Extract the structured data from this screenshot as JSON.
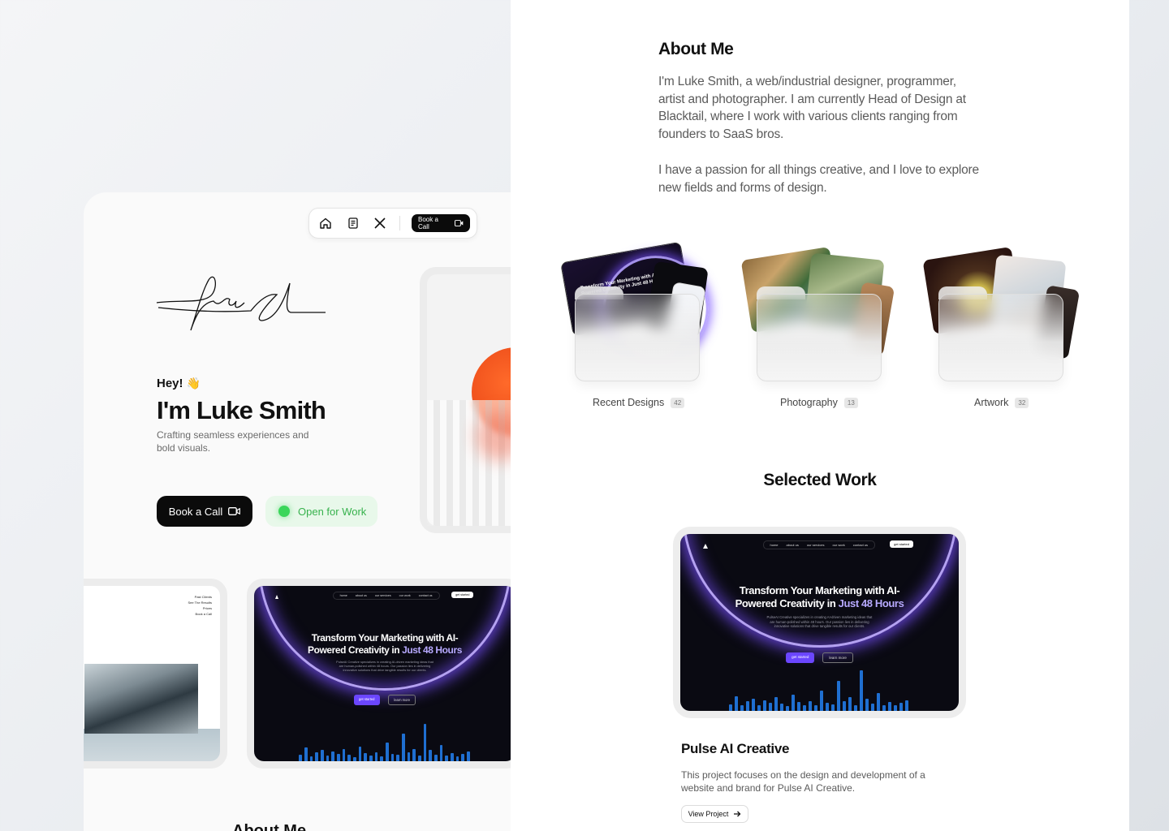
{
  "nav": {
    "icons": [
      "home-icon",
      "blog-icon",
      "x-logo-icon"
    ],
    "book_label": "Book a Call"
  },
  "hero": {
    "greeting": "Hey!",
    "greeting_emoji": "👋",
    "name": "I'm Luke Smith",
    "tagline": "Crafting seamless experiences and bold visuals.",
    "book_button": "Book a Call",
    "status_label": "Open for Work"
  },
  "arch_site": {
    "menu": [
      "Past Clients",
      "See The Results",
      "Prices",
      "Book a Call"
    ]
  },
  "pulse": {
    "nav": [
      "home",
      "about us",
      "our services",
      "our work",
      "contact us"
    ],
    "get_started": "get started",
    "title_line1": "Transform Your Marketing with AI-",
    "title_line2_a": "Powered Creativity in ",
    "title_line2_b": "Just 48 Hours",
    "desc": "PulseAI Creative specializes in creating AI-driven marketing ideas that are human-polished within 48 hours. Our passion lies in delivering innovative solutions that drive tangible results for our clients.",
    "btn_primary": "get started",
    "btn_secondary": "learn more",
    "bars": [
      10,
      22,
      8,
      14,
      18,
      9,
      16,
      12,
      20,
      11,
      7,
      24,
      13,
      9,
      15,
      8,
      30,
      12,
      10,
      44,
      14,
      20,
      9,
      60,
      18,
      11,
      26,
      9,
      13,
      8,
      12,
      16
    ]
  },
  "about_peek": "About Me",
  "about": {
    "title": "About Me",
    "p1": "I'm Luke Smith, a web/industrial designer, programmer, artist and photographer. I am currently Head of Design at Blacktail, where I work with various clients ranging from founders to SaaS bros.",
    "p2": "I have a passion for all things creative, and I love to explore new fields and forms of design."
  },
  "folders": [
    {
      "label": "Recent Designs",
      "count": "42"
    },
    {
      "label": "Photography",
      "count": "13"
    },
    {
      "label": "Artwork",
      "count": "32"
    }
  ],
  "selected": {
    "title": "Selected Work",
    "project_title": "Pulse AI Creative",
    "project_desc": "This project focuses on the design and development of a website and brand for Pulse AI Creative.",
    "view_button": "View Project"
  }
}
